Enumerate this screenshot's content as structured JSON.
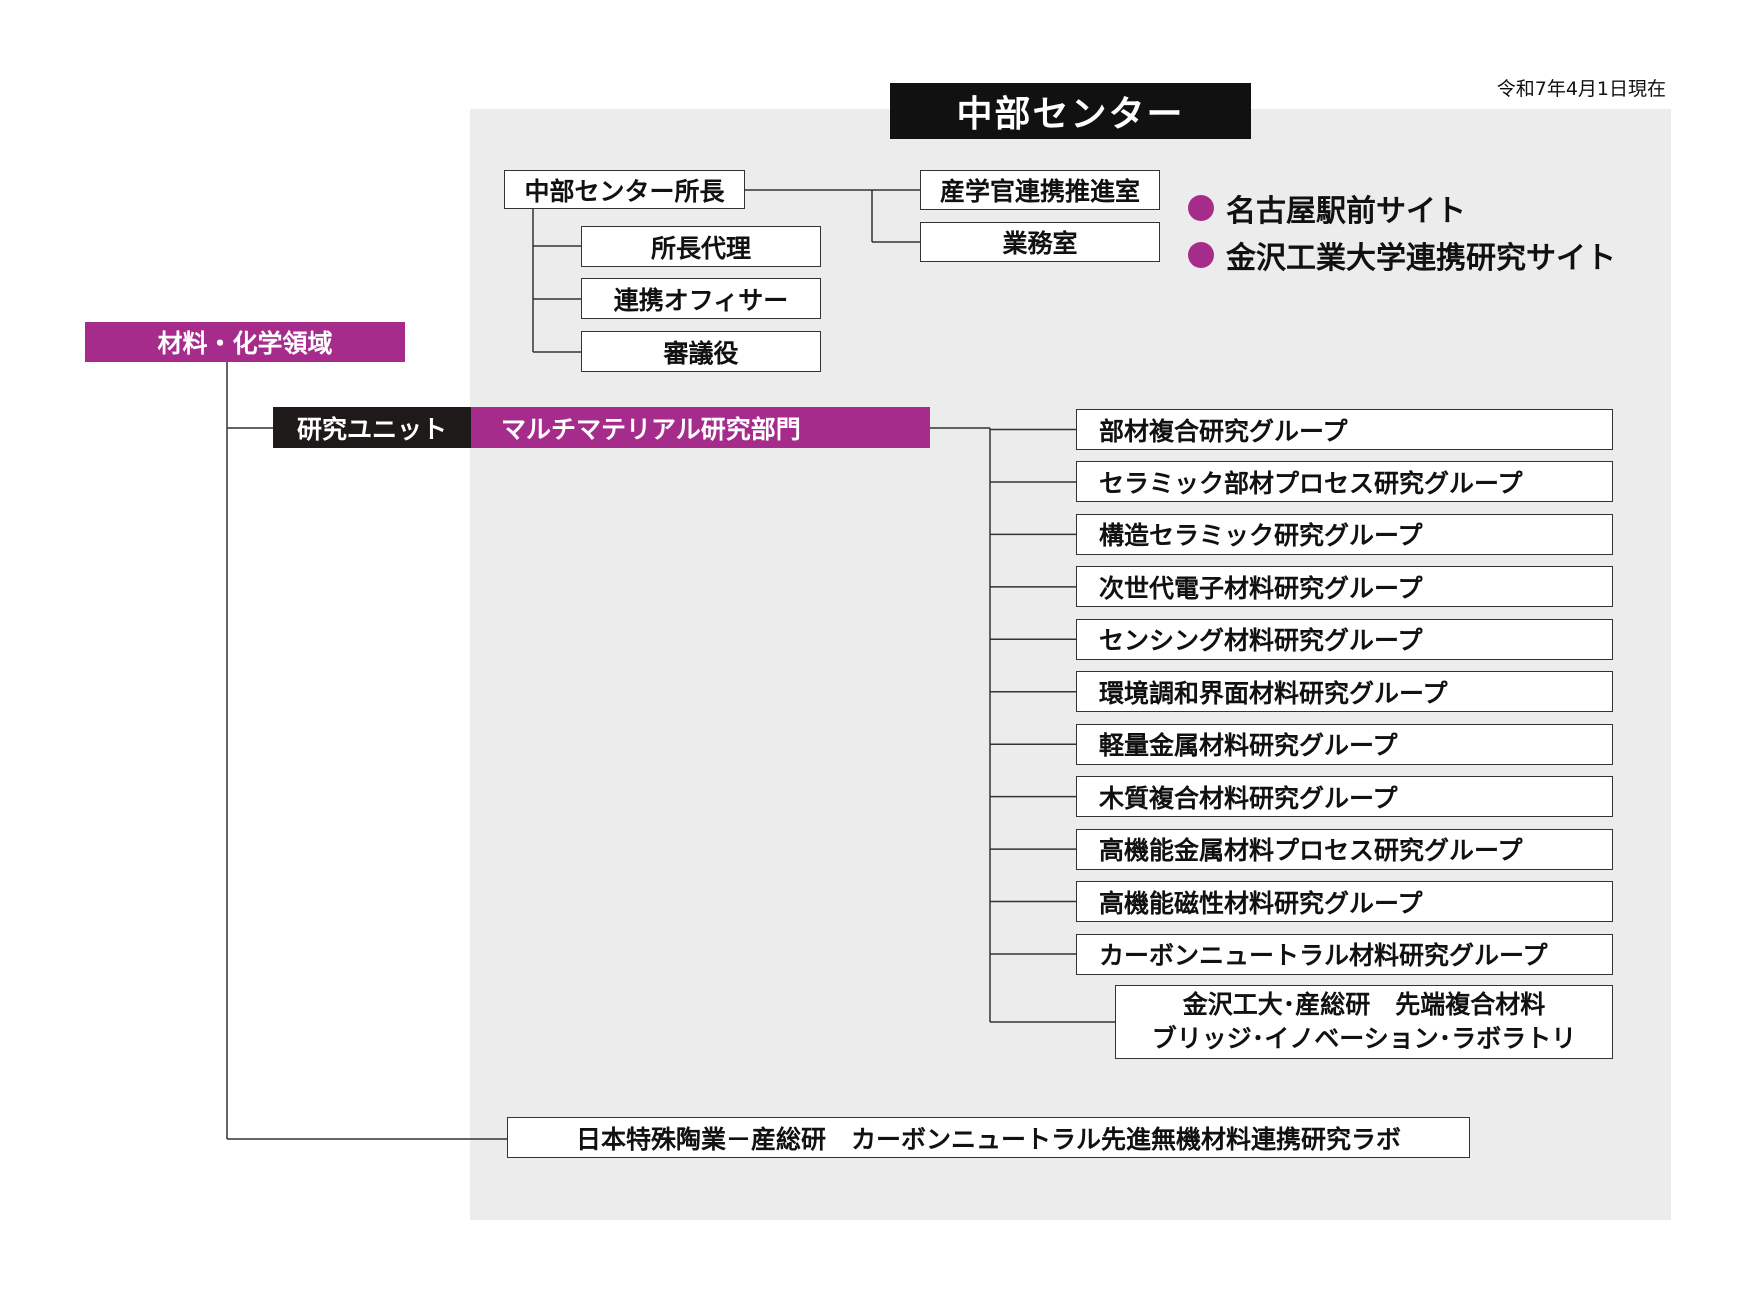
{
  "date_note": "令和7年4月1日現在",
  "center": {
    "title": "中部センター",
    "director": "中部センター所長",
    "director_staff": [
      "所長代理",
      "連携オフィサー",
      "審議役"
    ],
    "offices": [
      "産学官連携推進室",
      "業務室"
    ]
  },
  "sites": [
    "名古屋駅前サイト",
    "金沢工業大学連携研究サイト"
  ],
  "domain": "材料・化学領域",
  "unit": {
    "label": "研究ユニット",
    "name": "マルチマテリアル研究部門",
    "groups": [
      "部材複合研究グループ",
      "セラミック部材プロセス研究グループ",
      "構造セラミック研究グループ",
      "次世代電子材料研究グループ",
      "センシング材料研究グループ",
      "環境調和界面材料研究グループ",
      "軽量金属材料研究グループ",
      "木質複合材料研究グループ",
      "高機能金属材料プロセス研究グループ",
      "高機能磁性材料研究グループ",
      "カーボンニュートラル材料研究グループ"
    ],
    "lab": {
      "line1": "金沢工大･産総研　先端複合材料",
      "line2": "ブリッジ･イノベーション･ラボラトリ"
    }
  },
  "joint_lab": "日本特殊陶業－産総研　カーボンニュートラル先進無機材料連携研究ラボ",
  "colors": {
    "accent": "#a62c8c",
    "dark": "#111111",
    "panel": "#ececec"
  }
}
